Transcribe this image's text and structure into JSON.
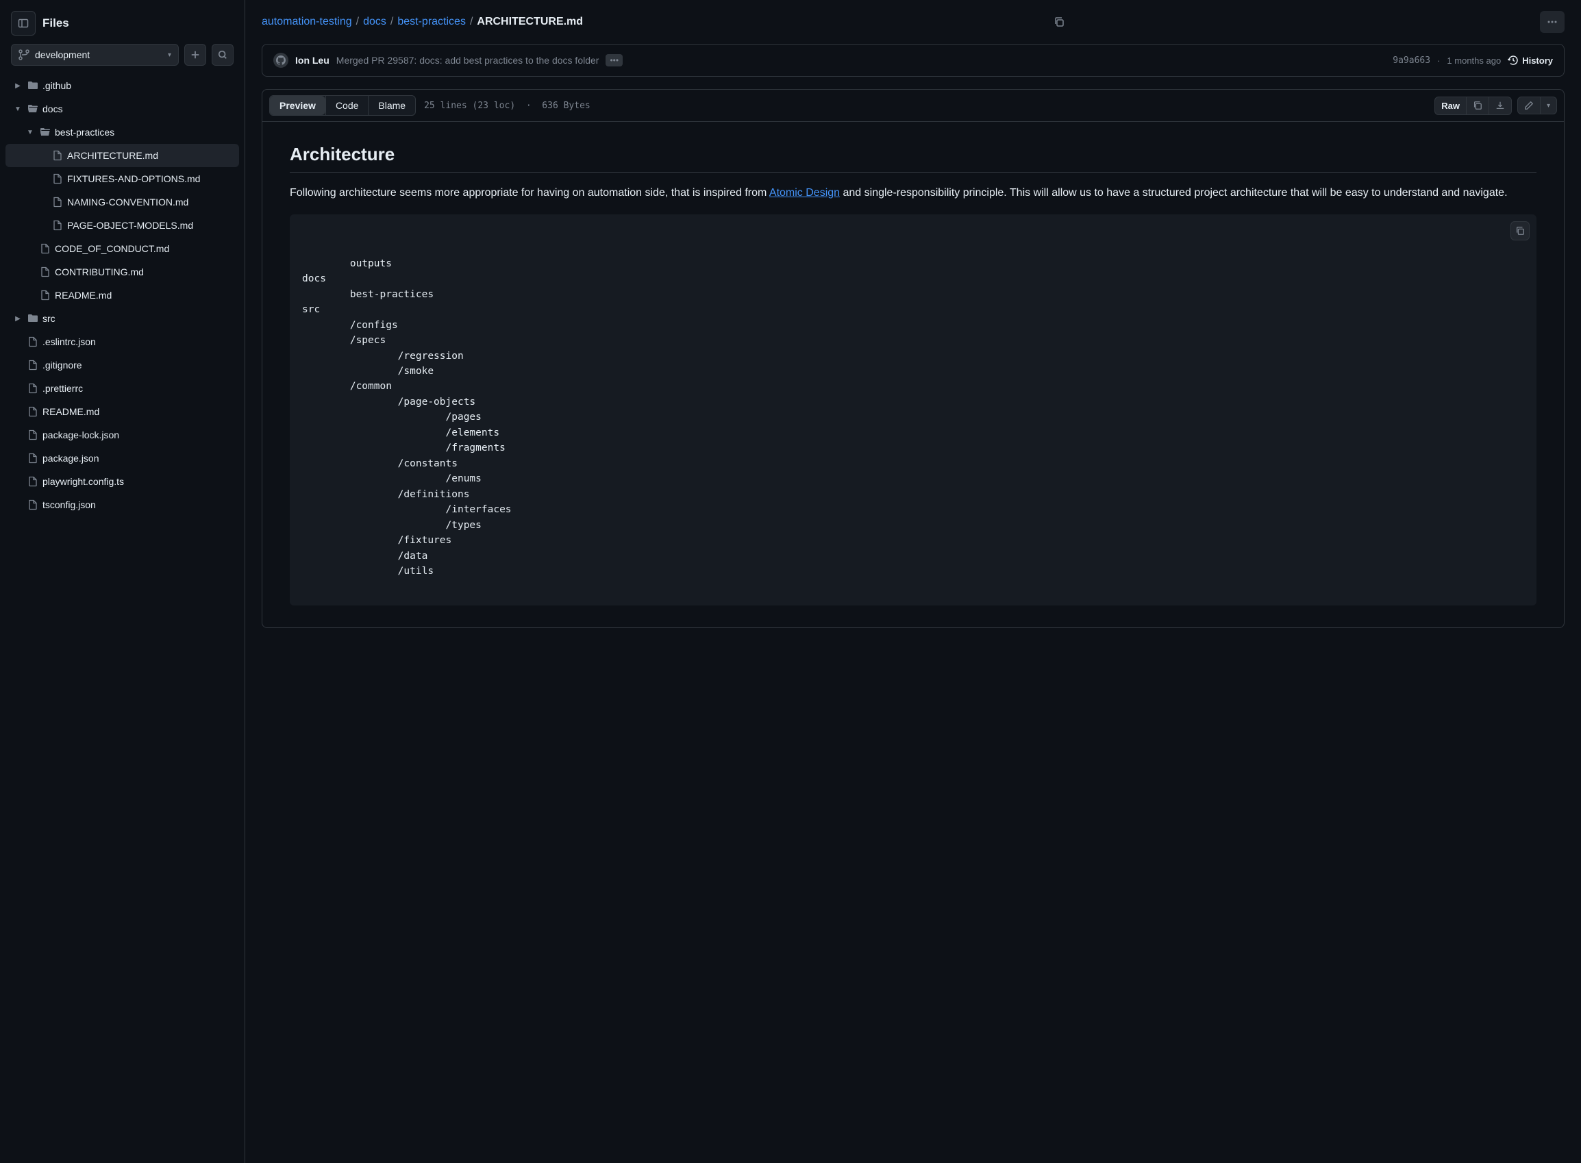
{
  "sidebar": {
    "title": "Files",
    "branch": "development"
  },
  "tree": {
    "items": [
      {
        "type": "folder",
        "label": ".github",
        "depth": 0,
        "chev": "right"
      },
      {
        "type": "folder-open",
        "label": "docs",
        "depth": 0,
        "chev": "down"
      },
      {
        "type": "folder-open",
        "label": "best-practices",
        "depth": 1,
        "chev": "down"
      },
      {
        "type": "file",
        "label": "ARCHITECTURE.md",
        "depth": 2,
        "active": true
      },
      {
        "type": "file",
        "label": "FIXTURES-AND-OPTIONS.md",
        "depth": 2
      },
      {
        "type": "file",
        "label": "NAMING-CONVENTION.md",
        "depth": 2
      },
      {
        "type": "file",
        "label": "PAGE-OBJECT-MODELS.md",
        "depth": 2
      },
      {
        "type": "file",
        "label": "CODE_OF_CONDUCT.md",
        "depth": 1
      },
      {
        "type": "file",
        "label": "CONTRIBUTING.md",
        "depth": 1
      },
      {
        "type": "file",
        "label": "README.md",
        "depth": 1
      },
      {
        "type": "folder",
        "label": "src",
        "depth": 0,
        "chev": "right"
      },
      {
        "type": "file",
        "label": ".eslintrc.json",
        "depth": 0
      },
      {
        "type": "file",
        "label": ".gitignore",
        "depth": 0
      },
      {
        "type": "file",
        "label": ".prettierrc",
        "depth": 0
      },
      {
        "type": "file",
        "label": "README.md",
        "depth": 0
      },
      {
        "type": "file",
        "label": "package-lock.json",
        "depth": 0
      },
      {
        "type": "file",
        "label": "package.json",
        "depth": 0
      },
      {
        "type": "file",
        "label": "playwright.config.ts",
        "depth": 0
      },
      {
        "type": "file",
        "label": "tsconfig.json",
        "depth": 0
      }
    ]
  },
  "breadcrumb": {
    "parts": [
      {
        "label": "automation-testing",
        "link": true
      },
      {
        "label": "docs",
        "link": true
      },
      {
        "label": "best-practices",
        "link": true
      },
      {
        "label": "ARCHITECTURE.md",
        "link": false
      }
    ]
  },
  "commit": {
    "author": "Ion Leu",
    "message": "Merged PR 29587: docs: add best practices to the docs folder",
    "sha": "9a9a663",
    "sep": "·",
    "time": "1 months ago",
    "history_label": "History"
  },
  "file": {
    "tabs": {
      "preview": "Preview",
      "code": "Code",
      "blame": "Blame"
    },
    "meta_lines": "25 lines (23 loc)",
    "meta_sep": "·",
    "meta_size": "636 Bytes",
    "raw_label": "Raw"
  },
  "doc": {
    "heading": "Architecture",
    "p1a": "Following architecture seems more appropriate for having on automation side, that is inspired from ",
    "link": "Atomic Design",
    "p1b": " and single-responsibility principle. This will allow us to have a structured project architecture that will be easy to understand and navigate.",
    "code": "outputs\ndocs\n        best-practices\nsrc\n        /configs\n        /specs\n                /regression\n                /smoke\n        /common\n                /page-objects\n                        /pages\n                        /elements\n                        /fragments\n                /constants\n                        /enums\n                /definitions\n                        /interfaces\n                        /types\n                /fixtures\n                /data\n                /utils"
  }
}
